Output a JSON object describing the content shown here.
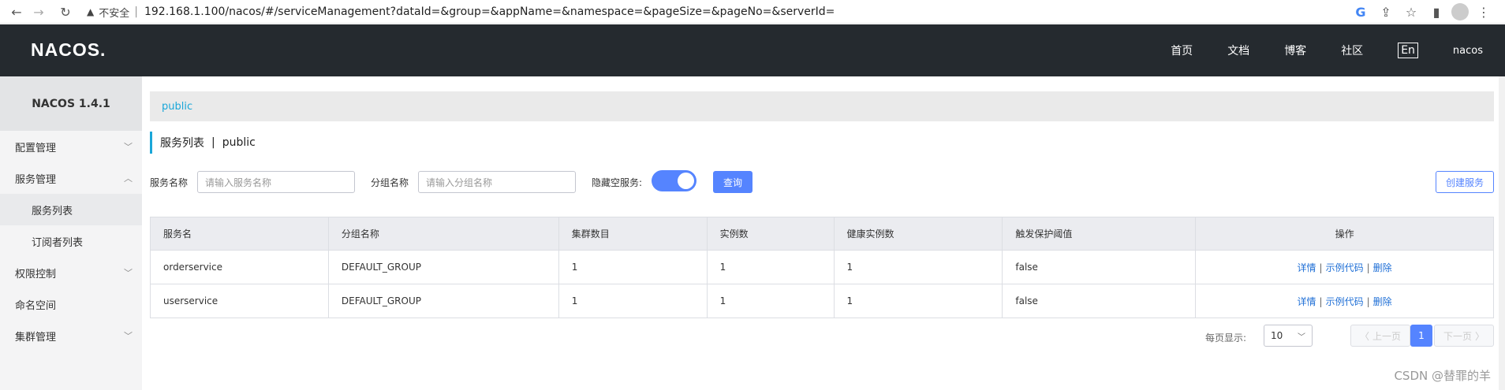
{
  "browser": {
    "insecure_label": "不安全",
    "url": "192.168.1.100/nacos/#/serviceManagement?dataId=&group=&appName=&namespace=&pageSize=&pageNo=&serverId="
  },
  "header": {
    "logo": "NACOS.",
    "nav": [
      "首页",
      "文档",
      "博客",
      "社区"
    ],
    "lang": "En",
    "user": "nacos"
  },
  "sidebar": {
    "version": "NACOS 1.4.1",
    "items": [
      {
        "label": "配置管理"
      },
      {
        "label": "服务管理"
      },
      {
        "label": "服务列表"
      },
      {
        "label": "订阅者列表"
      },
      {
        "label": "权限控制"
      },
      {
        "label": "命名空间"
      },
      {
        "label": "集群管理"
      }
    ]
  },
  "namespace_bar": "public",
  "page_title": {
    "label": "服务列表",
    "sep": "|",
    "namespace": "public"
  },
  "filters": {
    "service_name_label": "服务名称",
    "service_name_placeholder": "请输入服务名称",
    "group_name_label": "分组名称",
    "group_name_placeholder": "请输入分组名称",
    "hide_empty_label": "隐藏空服务:",
    "hide_empty_on": true,
    "query_button": "查询",
    "create_button": "创建服务"
  },
  "table": {
    "columns": [
      "服务名",
      "分组名称",
      "集群数目",
      "实例数",
      "健康实例数",
      "触发保护阈值",
      "操作"
    ],
    "rows": [
      [
        "orderservice",
        "DEFAULT_GROUP",
        "1",
        "1",
        "1",
        "false"
      ],
      [
        "userservice",
        "DEFAULT_GROUP",
        "1",
        "1",
        "1",
        "false"
      ]
    ],
    "actions": [
      "详情",
      "示例代码",
      "删除"
    ]
  },
  "pagination": {
    "page_size_label": "每页显示:",
    "page_size": "10",
    "prev": "上一页",
    "current": "1",
    "next": "下一页"
  },
  "watermark": "CSDN @替罪的羊"
}
